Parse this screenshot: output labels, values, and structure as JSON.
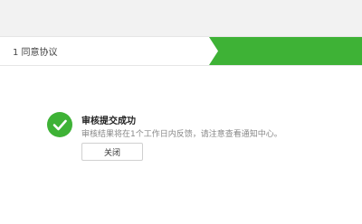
{
  "steps": [
    {
      "label": "1 同意协议",
      "active": false
    },
    {
      "label": "",
      "active": true
    }
  ],
  "result": {
    "icon": "check-circle-icon",
    "title": "审核提交成功",
    "description": "审核结果将在1个工作日内反馈，请注意查看通知中心。",
    "close_label": "关闭"
  },
  "colors": {
    "accent_green": "#3eb236",
    "top_band": "#f2f2f2"
  }
}
